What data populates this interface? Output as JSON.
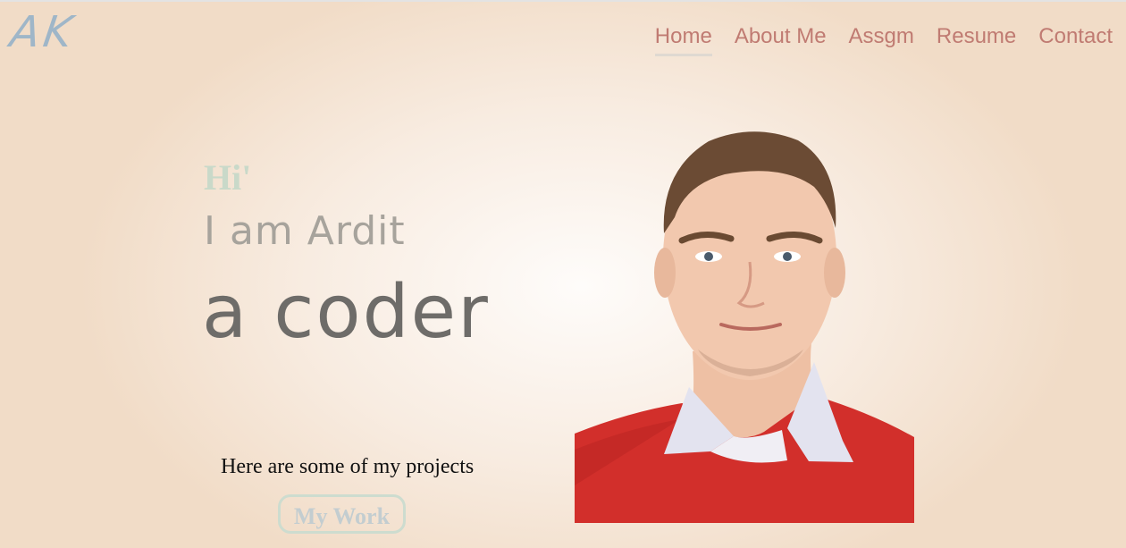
{
  "logo": {
    "text": "AK"
  },
  "nav": {
    "items": [
      {
        "label": "Home",
        "active": true
      },
      {
        "label": "About Me",
        "active": false
      },
      {
        "label": "Assgm",
        "active": false
      },
      {
        "label": "Resume",
        "active": false
      },
      {
        "label": "Contact",
        "active": false
      }
    ]
  },
  "hero": {
    "greeting": "Hi'",
    "intro": "I am Ardit",
    "role": "a coder",
    "projects_text": "Here are some of my projects",
    "button_label": "My Work"
  },
  "colors": {
    "nav_text": "#c07b72",
    "greeting": "#c9d9c9",
    "button_border": "#cddccf",
    "logo": "#9fb6c8"
  }
}
